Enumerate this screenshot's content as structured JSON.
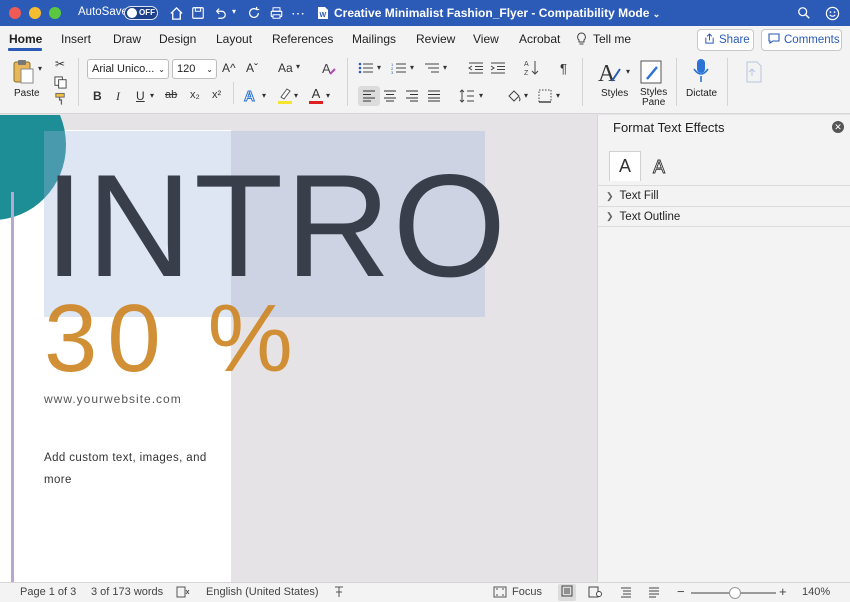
{
  "titlebar": {
    "autosave_label": "AutoSave",
    "autosave_state": "OFF",
    "document_title": "Creative Minimalist Fashion_Flyer",
    "separator": "-",
    "mode": "Compatibility Mode"
  },
  "tabs": [
    "Home",
    "Insert",
    "Draw",
    "Design",
    "Layout",
    "References",
    "Mailings",
    "Review",
    "View",
    "Acrobat"
  ],
  "tell_me": "Tell me",
  "share_label": "Share",
  "comments_label": "Comments",
  "ribbon": {
    "paste_label": "Paste",
    "font_name": "Arial Unico...",
    "font_size": "120",
    "bold": "B",
    "italic": "I",
    "underline": "U",
    "strike": "ab",
    "sub": "x₂",
    "sup": "x²",
    "font_color_glyph": "A",
    "grow": "A^",
    "shrink": "Aˇ",
    "change_case": "Aa",
    "styles_label": "Styles",
    "styles_pane_label1": "Styles",
    "styles_pane_label2": "Pane",
    "dictate_label": "Dictate",
    "pilcrow": "¶"
  },
  "document": {
    "heading": "INTRO",
    "discount": "30 %",
    "website": "www.yourwebsite.com",
    "body": "Add custom text, images, and more"
  },
  "panel": {
    "title": "Format Text Effects",
    "tab_fill_glyph": "A",
    "tab_outline_glyph": "A",
    "sections": [
      "Text Fill",
      "Text Outline"
    ]
  },
  "statusbar": {
    "page": "Page 1 of 3",
    "words": "3 of 173 words",
    "language": "English (United States)",
    "focus": "Focus",
    "zoom": "140%"
  },
  "colors": {
    "titlebar": "#2b5ab7",
    "teal_shape": "#1d8d96",
    "heading": "#383e4a",
    "discount": "#cf8a2c"
  }
}
